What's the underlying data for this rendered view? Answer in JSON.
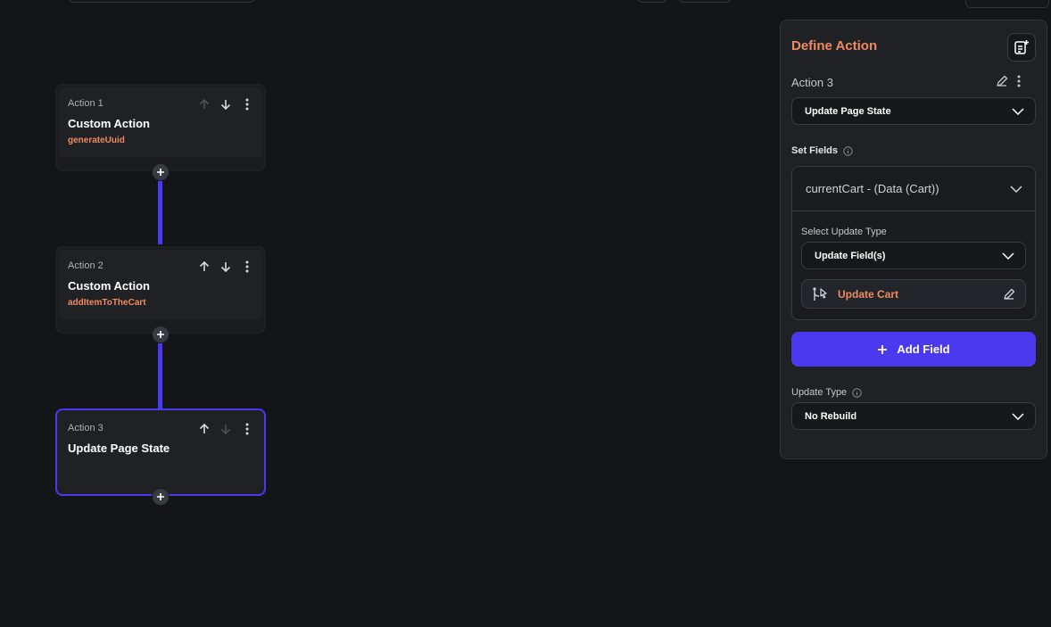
{
  "canvas": {
    "actions": [
      {
        "label": "Action 1",
        "title": "Custom Action",
        "subtitle": "generateUuid"
      },
      {
        "label": "Action 2",
        "title": "Custom Action",
        "subtitle": "addItemToTheCart"
      },
      {
        "label": "Action 3",
        "title": "Update Page State",
        "subtitle": ""
      }
    ]
  },
  "panel": {
    "title": "Define Action",
    "action_name": "Action 3",
    "action_type": "Update Page State",
    "set_fields_label": "Set Fields",
    "field": {
      "name": "currentCart - (Data (Cart))",
      "select_update_type_label": "Select Update Type",
      "update_type_value": "Update Field(s)",
      "update_item_label": "Update Cart"
    },
    "add_field_label": "Add Field",
    "update_type_label": "Update Type",
    "update_type_value": "No Rebuild"
  },
  "colors": {
    "accent": "#4b39ef",
    "highlight": "#ee8b60",
    "background": "#141518",
    "panel": "#1f2125"
  }
}
